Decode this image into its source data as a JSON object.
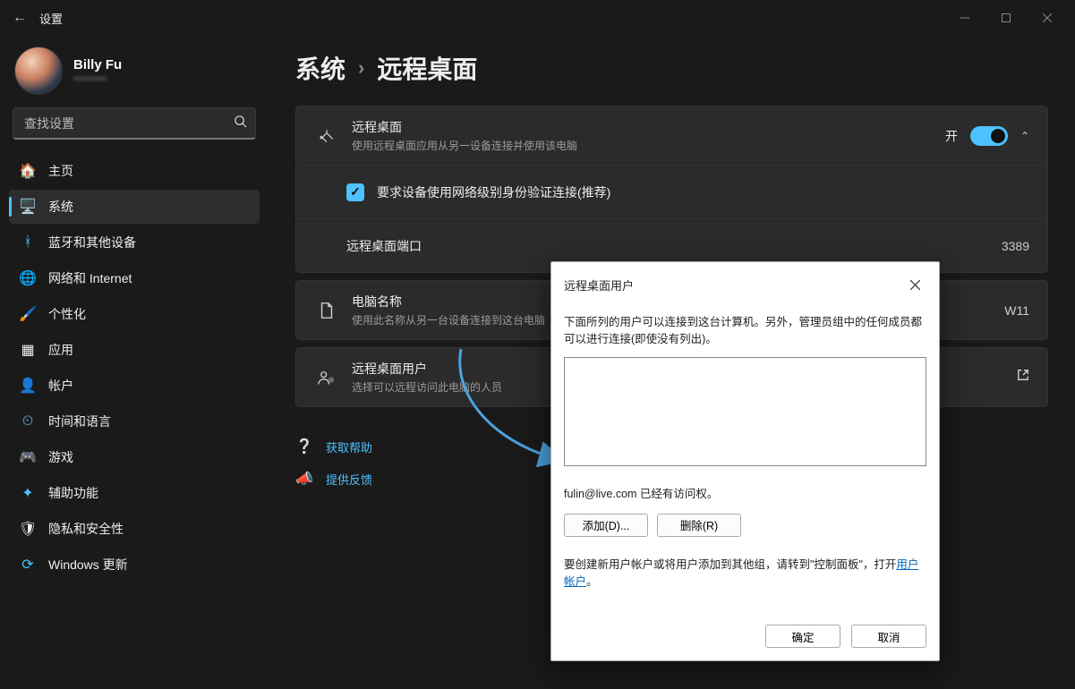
{
  "window": {
    "title": "设置"
  },
  "user": {
    "name": "Billy Fu",
    "email": "•••••••••"
  },
  "search": {
    "placeholder": "查找设置"
  },
  "nav": {
    "items": [
      {
        "icon": "🏠",
        "label": "主页"
      },
      {
        "icon": "🖥️",
        "label": "系统"
      },
      {
        "icon": "ᚼ",
        "label": "蓝牙和其他设备"
      },
      {
        "icon": "🌐",
        "label": "网络和 Internet"
      },
      {
        "icon": "🖌️",
        "label": "个性化"
      },
      {
        "icon": "▦",
        "label": "应用"
      },
      {
        "icon": "👤",
        "label": "帐户"
      },
      {
        "icon": "⏲",
        "label": "时间和语言"
      },
      {
        "icon": "🎮",
        "label": "游戏"
      },
      {
        "icon": "✦",
        "label": "辅助功能"
      },
      {
        "icon": "🛡",
        "label": "隐私和安全性"
      },
      {
        "icon": "⟳",
        "label": "Windows 更新"
      }
    ]
  },
  "breadcrumb": {
    "root": "系统",
    "leaf": "远程桌面"
  },
  "rdp": {
    "header_title": "远程桌面",
    "header_sub": "使用远程桌面应用从另一设备连接并使用该电脑",
    "toggle_label": "开",
    "nla_label": "要求设备使用网络级别身份验证连接(推荐)",
    "port_label": "远程桌面端口",
    "port_value": "3389",
    "pcname_title": "电脑名称",
    "pcname_sub": "使用此名称从另一台设备连接到这台电脑",
    "pcname_value": "W11",
    "users_title": "远程桌面用户",
    "users_sub": "选择可以远程访问此电脑的人员"
  },
  "help": {
    "get_help": "获取帮助",
    "feedback": "提供反馈"
  },
  "dialog": {
    "title": "远程桌面用户",
    "desc": "下面所列的用户可以连接到这台计算机。另外，管理员组中的任何成员都可以进行连接(即使没有列出)。",
    "status": "fulin@live.com 已经有访问权。",
    "add": "添加(D)...",
    "remove": "删除(R)",
    "note_prefix": "要创建新用户帐户或将用户添加到其他组，请转到\"控制面板\"，打开",
    "note_link": "用户帐户",
    "note_suffix": "。",
    "ok": "确定",
    "cancel": "取消"
  }
}
